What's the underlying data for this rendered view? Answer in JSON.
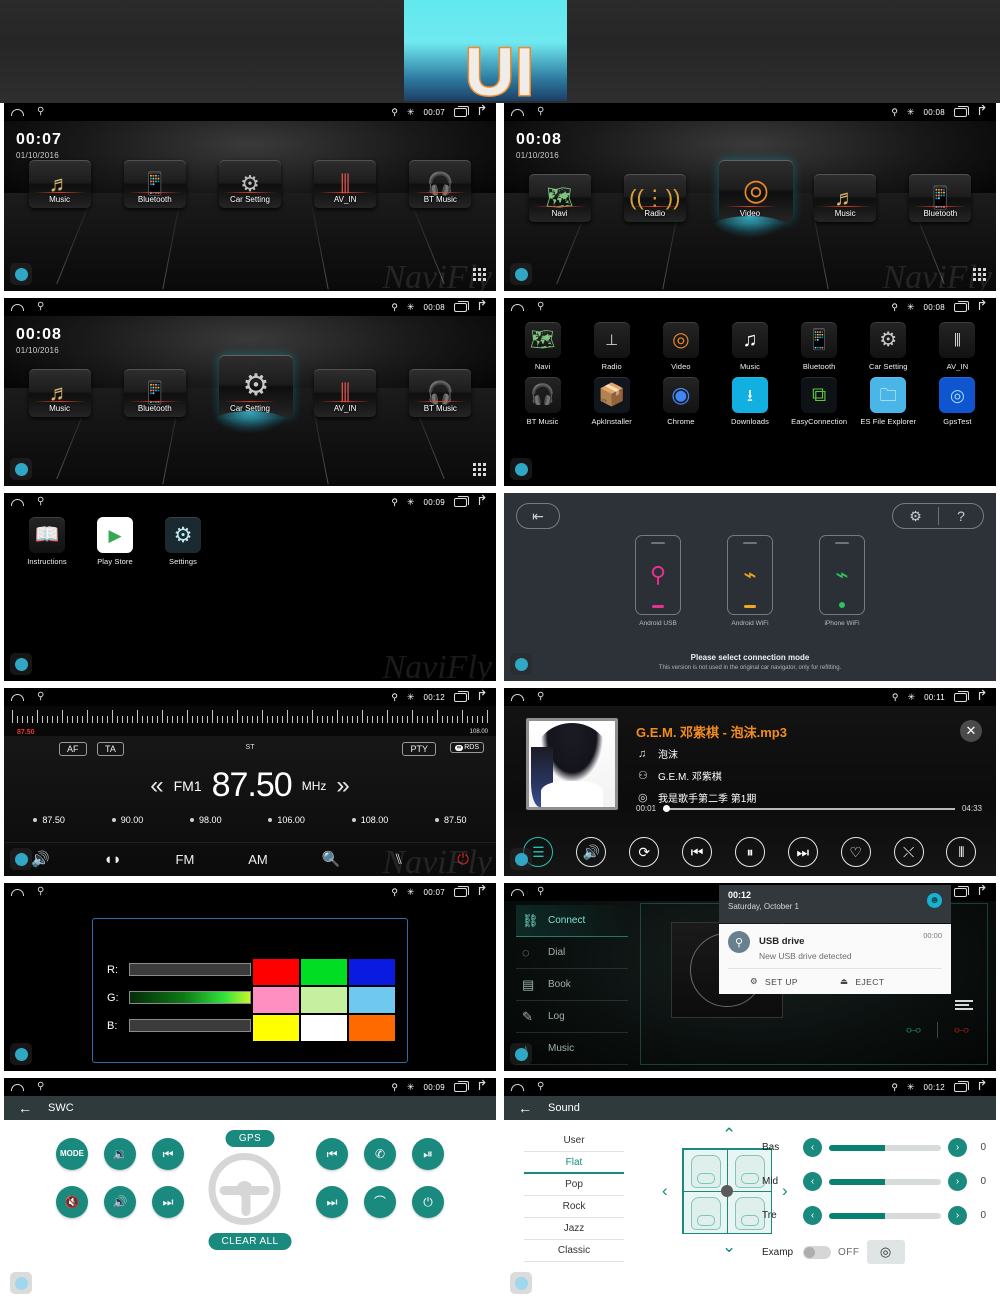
{
  "banner": {
    "logo_text": "UI"
  },
  "statusbar_icons": {
    "home": "home-icon",
    "usb": "usb-icon",
    "gps": "gps-pin-icon",
    "bluetooth": "bluetooth-icon",
    "recents": "recents-icon",
    "back": "back-icon"
  },
  "screens": {
    "home1": {
      "time": "00:07",
      "date": "01/10/2016",
      "status_time": "00:07",
      "watermark": "NaviFly",
      "items": [
        {
          "label": "Music",
          "icon": "music-note-icon"
        },
        {
          "label": "Bluetooth",
          "icon": "bluetooth-phone-icon"
        },
        {
          "label": "Car Setting",
          "icon": "gear-wrench-icon"
        },
        {
          "label": "AV_IN",
          "icon": "rca-plug-icon"
        },
        {
          "label": "BT Music",
          "icon": "bt-music-icon"
        }
      ]
    },
    "home2": {
      "time": "00:08",
      "date": "01/10/2016",
      "status_time": "00:08",
      "watermark": "NaviFly",
      "active_index": 2,
      "items": [
        {
          "label": "Navi",
          "icon": "map-icon"
        },
        {
          "label": "Radio",
          "icon": "radio-antenna-icon"
        },
        {
          "label": "Video",
          "icon": "film-reel-icon"
        },
        {
          "label": "Music",
          "icon": "music-note-icon"
        },
        {
          "label": "Bluetooth",
          "icon": "bluetooth-phone-icon"
        }
      ]
    },
    "home3": {
      "time": "00:08",
      "date": "01/10/2016",
      "status_time": "00:08",
      "watermark": "NaviFly",
      "active_index": 2,
      "items": [
        {
          "label": "Music",
          "icon": "music-note-icon"
        },
        {
          "label": "Bluetooth",
          "icon": "bluetooth-phone-icon"
        },
        {
          "label": "Car Setting",
          "icon": "gear-wrench-icon"
        },
        {
          "label": "AV_IN",
          "icon": "rca-plug-icon"
        },
        {
          "label": "BT Music",
          "icon": "bt-music-icon"
        }
      ]
    },
    "drawer1": {
      "status_time": "00:08",
      "row1": [
        {
          "label": "Navi",
          "icon": "map-icon"
        },
        {
          "label": "Radio",
          "icon": "radio-antenna-icon"
        },
        {
          "label": "Video",
          "icon": "film-reel-icon"
        },
        {
          "label": "Music",
          "icon": "music-note-icon"
        },
        {
          "label": "Bluetooth",
          "icon": "bluetooth-phone-icon"
        },
        {
          "label": "Car Setting",
          "icon": "gear-wrench-icon"
        },
        {
          "label": "AV_IN",
          "icon": "rca-plug-icon"
        }
      ],
      "row2": [
        {
          "label": "BT Music",
          "icon": "bt-headphone-icon"
        },
        {
          "label": "ApkInstaller",
          "icon": "package-box-icon"
        },
        {
          "label": "Chrome",
          "icon": "chrome-icon"
        },
        {
          "label": "Downloads",
          "icon": "download-icon"
        },
        {
          "label": "EasyConnection",
          "icon": "easyconnection-icon"
        },
        {
          "label": "ES File Explorer",
          "icon": "folder-es-icon"
        },
        {
          "label": "GpsTest",
          "icon": "gps-radar-icon"
        }
      ]
    },
    "drawer2": {
      "status_time": "00:09",
      "watermark": "NaviFly",
      "items": [
        {
          "label": "Instructions",
          "icon": "book-icon"
        },
        {
          "label": "Play Store",
          "icon": "play-store-icon"
        },
        {
          "label": "Settings",
          "icon": "gear-icon"
        }
      ]
    },
    "easyconnection": {
      "exit_icon": "exit-icon",
      "settings_icon": "gear-icon",
      "help_icon": "help-icon",
      "phones": [
        {
          "label": "Android USB",
          "icon": "usb-icon",
          "color": "#e8308f"
        },
        {
          "label": "Android WiFi",
          "icon": "wifi-icon",
          "color": "#f0a81e"
        },
        {
          "label": "iPhone WiFi",
          "icon": "wifi-icon",
          "color": "#2ec35e"
        }
      ],
      "message_main": "Please select connection mode",
      "message_sub": "This version is not used in the original car navigator, only for refitting."
    },
    "radio": {
      "status_time": "00:12",
      "watermark": "NaviFly",
      "scale_min": "87.50",
      "scale_max": "108.00",
      "af_label": "AF",
      "ta_label": "TA",
      "st_label": "ST",
      "pty_label": "PTY",
      "rds_label": "RDS",
      "band": "FM1",
      "frequency": "87.50",
      "unit": "MHz",
      "prev_icon": "chevron-left-double-icon",
      "next_icon": "chevron-right-double-icon",
      "presets": [
        "87.50",
        "90.00",
        "98.00",
        "106.00",
        "108.00",
        "87.50"
      ],
      "toolbar": [
        {
          "label": "",
          "icon": "volume-icon"
        },
        {
          "label": "",
          "icon": "balance-icon"
        },
        {
          "label": "FM",
          "icon": "fm-band-icon"
        },
        {
          "label": "AM",
          "icon": "am-band-icon"
        },
        {
          "label": "",
          "icon": "search-scan-icon"
        },
        {
          "label": "",
          "icon": "equalizer-icon"
        },
        {
          "label": "",
          "icon": "power-icon"
        }
      ]
    },
    "music": {
      "status_time": "00:11",
      "track_title": "G.E.M. 邓紫棋 - 泡沫.mp3",
      "song": "泡沫",
      "artist": "G.E.M. 邓紫棋",
      "album": "我是歌手第二季 第1期",
      "elapsed": "00:01",
      "duration": "04:33",
      "song_icon": "music-note-icon",
      "artist_icon": "person-icon",
      "album_icon": "disc-icon",
      "close_icon": "close-icon",
      "controls": [
        {
          "icon": "playlist-icon",
          "active": true
        },
        {
          "icon": "volume-icon",
          "active": false
        },
        {
          "icon": "repeat-icon",
          "active": false
        },
        {
          "icon": "previous-icon",
          "active": false
        },
        {
          "icon": "pause-icon",
          "active": false
        },
        {
          "icon": "next-icon",
          "active": false
        },
        {
          "icon": "heart-icon",
          "active": false
        },
        {
          "icon": "shuffle-icon",
          "active": false
        },
        {
          "icon": "equalizer-icon",
          "active": false
        }
      ]
    },
    "rgb": {
      "status_time": "00:07",
      "channels": [
        {
          "label": "R:",
          "value": "0",
          "filled": false,
          "color": "#ff0000"
        },
        {
          "label": "G:",
          "value": "255",
          "filled": true,
          "color": "#00ff00"
        },
        {
          "label": "B:",
          "value": "0",
          "filled": false,
          "color": "#0000ff"
        }
      ],
      "swatches": [
        "#ff0000",
        "#00dd22",
        "#0a1ae0",
        "#ff8fc0",
        "#c6f0a0",
        "#6ec8f0",
        "#ffff00",
        "#ffffff",
        "#ff6a00"
      ]
    },
    "bluetooth": {
      "menu": [
        {
          "label": "Connect",
          "icon": "link-icon",
          "active": true
        },
        {
          "label": "Dial",
          "icon": "dialpad-icon",
          "active": false
        },
        {
          "label": "Book",
          "icon": "contacts-book-icon",
          "active": false
        },
        {
          "label": "Log",
          "icon": "call-log-icon",
          "active": false
        },
        {
          "label": "Music",
          "icon": "music-note-icon",
          "active": false
        }
      ],
      "bt_icon": "bluetooth-icon",
      "notification": {
        "time": "00:12",
        "date": "Saturday, October 1",
        "avatar_icon": "user-avatar-icon",
        "app_icon": "usb-icon",
        "title": "USB drive",
        "subtitle": "New USB drive detected",
        "timestamp": "00:00",
        "actions": [
          {
            "label": "SET UP",
            "icon": "gear-icon"
          },
          {
            "label": "EJECT",
            "icon": "eject-icon"
          }
        ]
      }
    },
    "swc": {
      "status_time": "00:09",
      "title": "SWC",
      "back_icon": "back-arrow-icon",
      "gps_label": "GPS",
      "clear_label": "CLEAR ALL",
      "wheel_icon": "steering-wheel-icon",
      "left_buttons": [
        {
          "label": "MODE",
          "icon": "mode-icon"
        },
        {
          "label": "",
          "icon": "volume-down-icon"
        },
        {
          "label": "",
          "icon": "previous-track-icon"
        },
        {
          "label": "",
          "icon": "mute-icon"
        },
        {
          "label": "",
          "icon": "volume-up-icon"
        },
        {
          "label": "",
          "icon": "next-track-icon"
        }
      ],
      "right_buttons": [
        {
          "label": "",
          "icon": "call-previous-icon"
        },
        {
          "label": "",
          "icon": "call-answer-icon"
        },
        {
          "label": "",
          "icon": "play-pause-icon"
        },
        {
          "label": "",
          "icon": "call-next-icon"
        },
        {
          "label": "",
          "icon": "call-hangup-icon"
        },
        {
          "label": "",
          "icon": "power-icon"
        }
      ]
    },
    "sound": {
      "status_time": "00:12",
      "title": "Sound",
      "back_icon": "back-arrow-icon",
      "presets": [
        {
          "label": "User",
          "active": false
        },
        {
          "label": "Flat",
          "active": true
        },
        {
          "label": "Pop",
          "active": false
        },
        {
          "label": "Rock",
          "active": false
        },
        {
          "label": "Jazz",
          "active": false
        },
        {
          "label": "Classic",
          "active": false
        }
      ],
      "fader_icons": {
        "up": "chevron-up-icon",
        "down": "chevron-down-icon",
        "left": "chevron-left-icon",
        "right": "chevron-right-icon"
      },
      "eq": [
        {
          "name": "Bas",
          "value": "0",
          "percent": 50
        },
        {
          "name": "Mid",
          "value": "0",
          "percent": 50
        },
        {
          "name": "Tre",
          "value": "0",
          "percent": 50
        }
      ],
      "examp_label": "Examp",
      "examp_state": "OFF",
      "examp_icon": "target-icon"
    }
  }
}
